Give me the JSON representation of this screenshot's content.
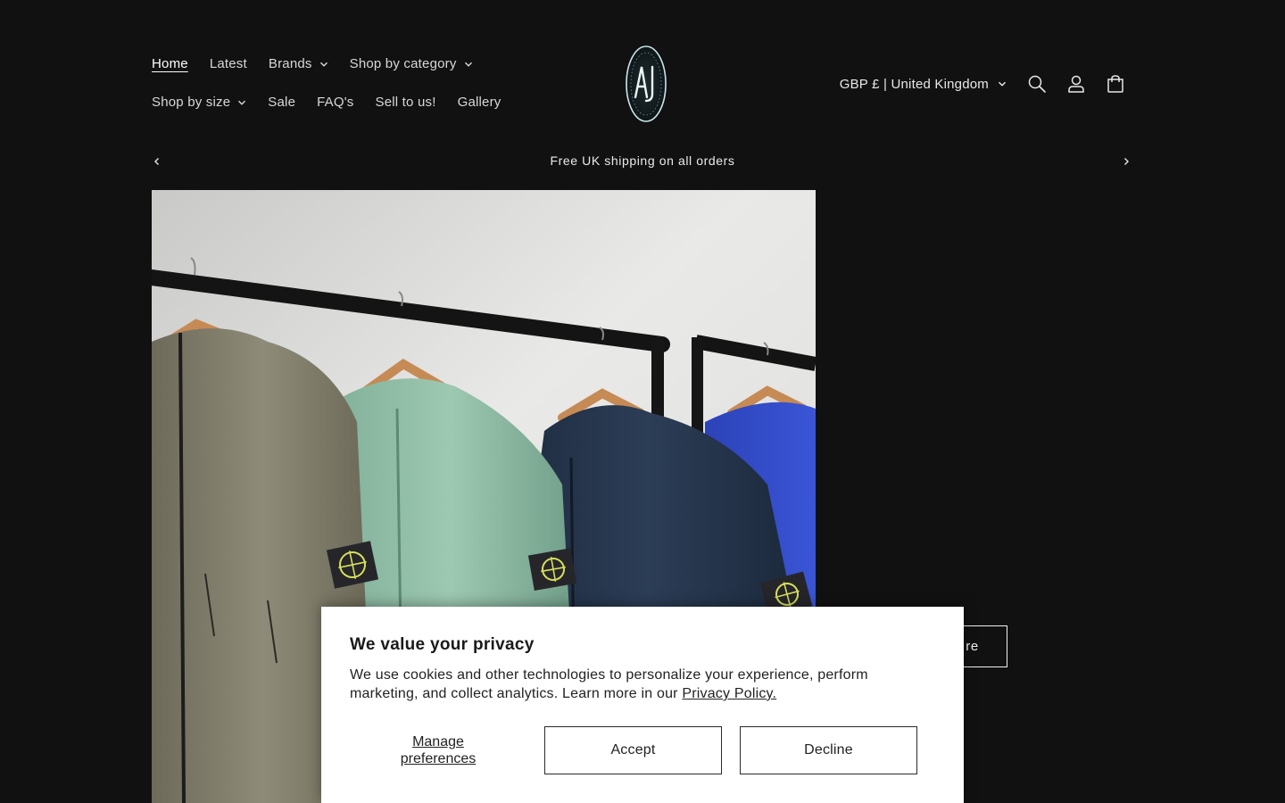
{
  "nav": {
    "items": [
      {
        "label": "Home",
        "active": true,
        "dropdown": false
      },
      {
        "label": "Latest",
        "active": false,
        "dropdown": false
      },
      {
        "label": "Brands",
        "active": false,
        "dropdown": true
      },
      {
        "label": "Shop by category",
        "active": false,
        "dropdown": true
      },
      {
        "label": "Shop by size",
        "active": false,
        "dropdown": true
      },
      {
        "label": "Sale",
        "active": false,
        "dropdown": false
      },
      {
        "label": "FAQ's",
        "active": false,
        "dropdown": false
      },
      {
        "label": "Sell to us!",
        "active": false,
        "dropdown": false
      },
      {
        "label": "Gallery",
        "active": false,
        "dropdown": false
      }
    ]
  },
  "logo": {
    "text": "AJ"
  },
  "header": {
    "currency_label": "GBP £ | United Kingdom",
    "icons": [
      "search-icon",
      "account-icon",
      "cart-icon"
    ]
  },
  "announcement": {
    "text": "Free UK shipping on all orders"
  },
  "hero": {
    "cta_label": "re"
  },
  "cookie": {
    "title": "We value your privacy",
    "body": "We use cookies and other technologies to personalize your experience, perform marketing, and collect analytics. Learn more in our ",
    "policy_link": "Privacy Policy.",
    "manage_label_line1": "Manage",
    "manage_label_line2": "preferences",
    "accept_label": "Accept",
    "decline_label": "Decline"
  },
  "colors": {
    "background": "#111112",
    "text": "#e6e6e6",
    "banner_bg": "#ffffff"
  }
}
